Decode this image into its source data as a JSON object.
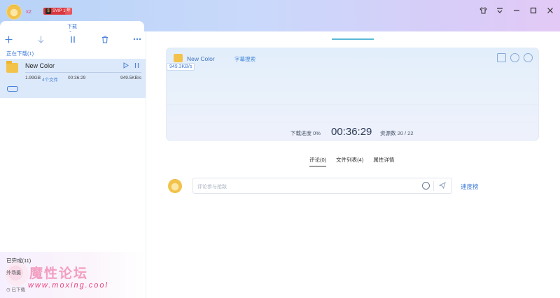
{
  "user": {
    "name": "xz",
    "vip_label": "SVIP 10",
    "svip_mark": "年"
  },
  "window": {
    "controls": [
      "shirt-icon",
      "menu-icon",
      "minimize-icon",
      "maximize-icon",
      "close-icon"
    ]
  },
  "sidebar": {
    "tab_label": "下载",
    "downloading_header": "正在下载(1)",
    "task": {
      "name": "New Color",
      "size": "1.99GB",
      "files": "4个文件",
      "time": "00:36:29",
      "speed": "949.5KB/s"
    },
    "completed_header": "已完成(11)",
    "completed_item": "外场摄",
    "footer_text": "已下载",
    "watermark_cn": "魔性论坛",
    "watermark_en": "www.moxing.cool"
  },
  "detail": {
    "title": "New Color",
    "subtitle": "字幕搜索",
    "speed_tag": "949.3KB/s",
    "progress_label": "下载进度 0%",
    "elapsed": "00:36:29",
    "sources": "资源数 20 / 22",
    "progress_value": 0
  },
  "tabs": [
    {
      "label": "评论(0)"
    },
    {
      "label": "文件列表(4)"
    },
    {
      "label": "属性详情"
    }
  ],
  "comment": {
    "placeholder": "评论参与抢敌",
    "speed_list_label": "速度榜"
  },
  "colors": {
    "accent": "#3f7bd8",
    "task_bg": "#dce9fb"
  }
}
